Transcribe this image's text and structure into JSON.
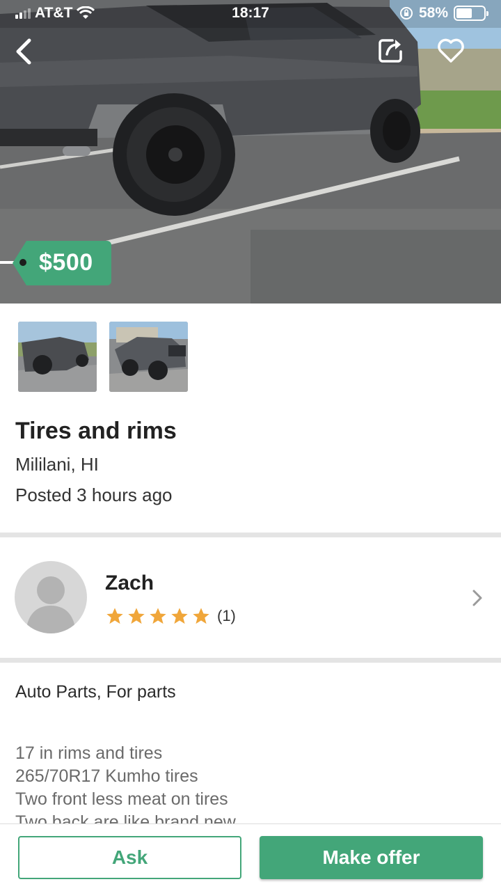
{
  "status_bar": {
    "carrier": "AT&T",
    "time": "18:17",
    "battery_percent": "58%",
    "battery_level": 0.58,
    "icons": [
      "signal-icon",
      "wifi-icon",
      "orientation-lock-icon",
      "battery-icon"
    ]
  },
  "nav": {
    "icons": [
      "back-arrow-icon",
      "share-icon",
      "heart-icon"
    ]
  },
  "listing": {
    "price": "$500",
    "title": "Tires and rims",
    "location": "Mililani, HI",
    "posted": "Posted 3 hours ago",
    "photo_count": 2,
    "categories": "Auto Parts, For parts",
    "description_lines": [
      "17 in rims and tires",
      "265/70R17 Kumho tires",
      "Two front less meat on tires",
      "Two back are like brand new"
    ]
  },
  "seller": {
    "name": "Zach",
    "rating": 5,
    "rating_count": "(1)"
  },
  "actions": {
    "ask_label": "Ask",
    "offer_label": "Make offer"
  },
  "colors": {
    "accent": "#43a679",
    "star": "#f0a63a",
    "divider": "#e4e4e4"
  }
}
